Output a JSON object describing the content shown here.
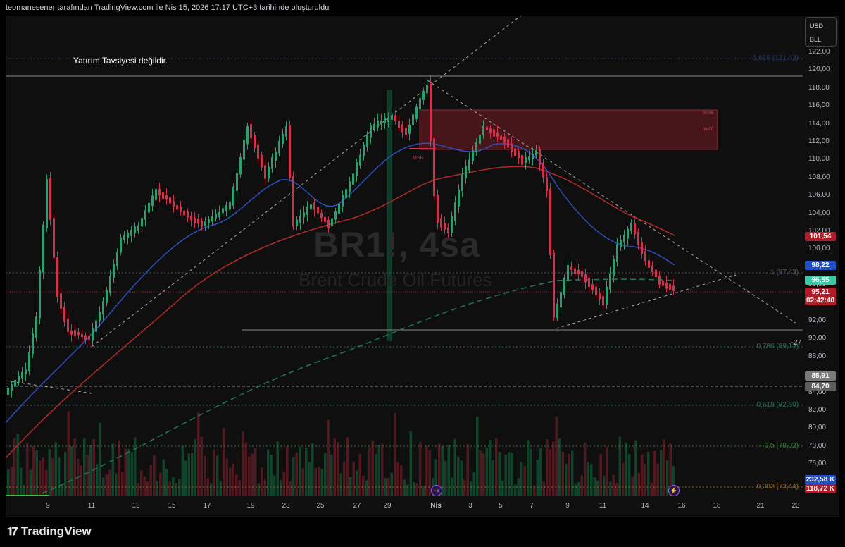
{
  "header": {
    "attribution": "teomanesener tarafından TradingView.com ile Nis 15, 2026 17:17 UTC+3 tarihinde oluşturuldu"
  },
  "chart": {
    "symbol": "BR1!, 4sa",
    "description": "Brent Crude Oil Futures",
    "note": "Yatırım Tavsiyesi değildir.",
    "currency": "USD",
    "unit": "BLL",
    "msb_label": "MSB",
    "zone_labels": [
      "0e-05",
      "0e-00"
    ]
  },
  "price_axis": [
    "122,00",
    "120,00",
    "118,00",
    "116,00",
    "114,00",
    "112,00",
    "110,00",
    "108,00",
    "106,00",
    "104,00",
    "102,00",
    "100,00",
    "98,00",
    "96,00",
    "94,00",
    "92,00",
    "90,00",
    "88,00",
    "86,00",
    "84,00",
    "82,00",
    "80,00",
    "78,00",
    "76,00",
    "74,00"
  ],
  "badges": [
    {
      "value": "101,54",
      "color": "#b21c26"
    },
    {
      "value": "98,22",
      "color": "#2151c9"
    },
    {
      "value": "96,55",
      "color": "#3cc9a6"
    },
    {
      "value": "95,21",
      "color": "#b21c26"
    },
    {
      "value": "02:42:40",
      "color": "#b21c26"
    },
    {
      "value": "85,91",
      "color": "#7a7a7a"
    },
    {
      "value": "84,70",
      "color": "#5e5e5e"
    },
    {
      "value": "232,58 K",
      "color": "#2151c9"
    },
    {
      "value": "118,72 K",
      "color": "#b21c26"
    }
  ],
  "fib_levels": [
    {
      "label": "1,618 (121,42)",
      "color": "#2a3a66"
    },
    {
      "label": "1 (97,43)",
      "color": "#555a66"
    },
    {
      "label": "0,786 (89,12)",
      "color": "#2b6b5a"
    },
    {
      "label": "0,618 (82,60)",
      "color": "#2b6b5a"
    },
    {
      "label": "0,5 (78,02)",
      "color": "#3d7a3d"
    },
    {
      "label": "0,382 (73,44)",
      "color": "#9c6a2a"
    }
  ],
  "fib_side_mark": "-27",
  "date_axis": [
    "9",
    "11",
    "13",
    "15",
    "17",
    "19",
    "23",
    "25",
    "27",
    "29",
    "Nis",
    "3",
    "5",
    "7",
    "9",
    "11",
    "14",
    "16",
    "18",
    "21",
    "23"
  ],
  "footer": {
    "brand": "TradingView"
  },
  "colors": {
    "bull": "#2e9e6e",
    "bear": "#d4304b",
    "ema_fast": "#2d4fc0",
    "ema_slow": "#b42a2a",
    "bg": "#0f0f0f"
  }
}
